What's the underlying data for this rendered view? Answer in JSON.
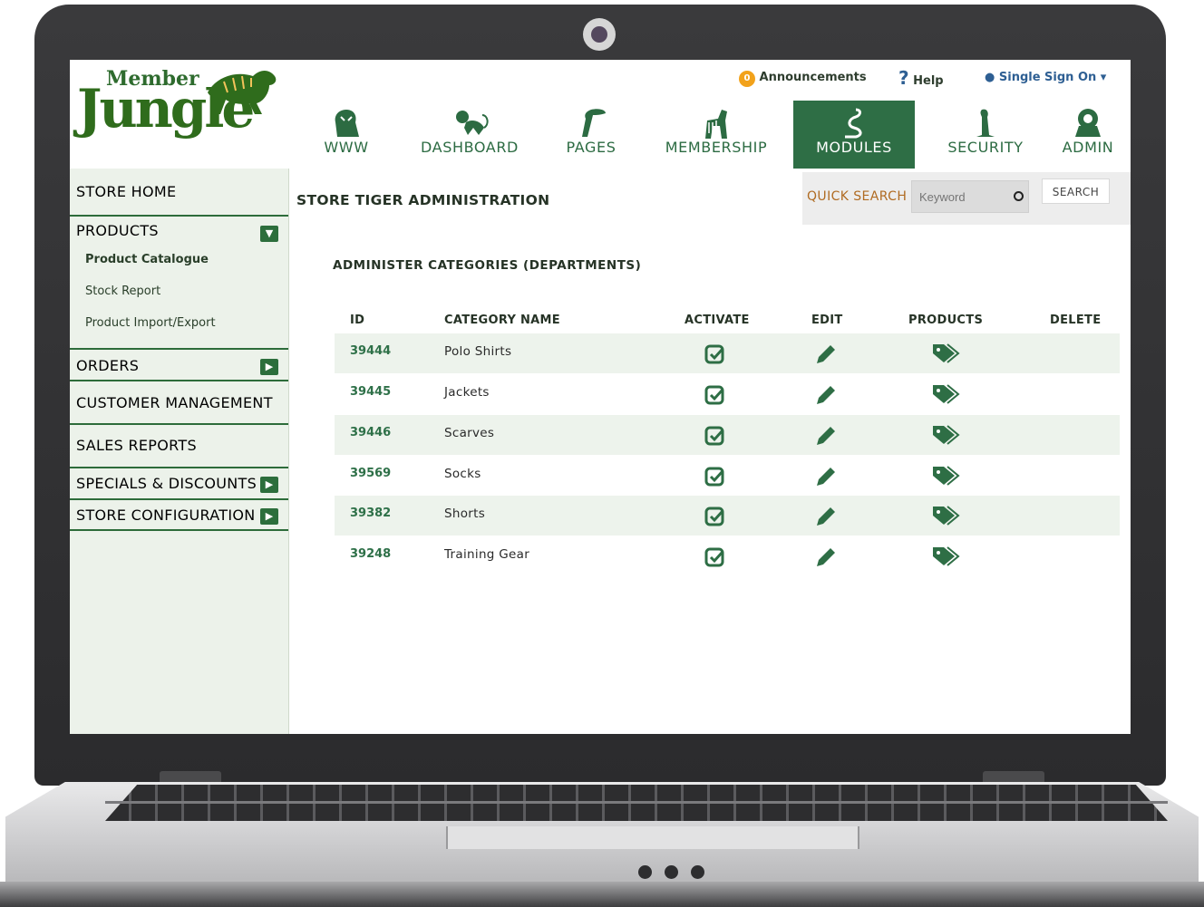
{
  "brand": {
    "word1": "Member",
    "word2": "Jungle"
  },
  "topbar": {
    "announcements_count": "0",
    "announcements": "Announcements",
    "help": "Help",
    "sso": "Single Sign On"
  },
  "tabs": [
    {
      "label": "WWW",
      "icon": "tiger-icon"
    },
    {
      "label": "DASHBOARD",
      "icon": "monkey-icon"
    },
    {
      "label": "PAGES",
      "icon": "toucan-icon"
    },
    {
      "label": "MEMBERSHIP",
      "icon": "zebra-icon"
    },
    {
      "label": "MODULES",
      "icon": "snake-icon",
      "active": true
    },
    {
      "label": "SECURITY",
      "icon": "meerkat-icon"
    },
    {
      "label": "ADMIN",
      "icon": "lion-icon"
    }
  ],
  "sidebar": {
    "store_home": "STORE HOME",
    "products": "PRODUCTS",
    "product_catalogue": "Product Catalogue",
    "stock_report": "Stock Report",
    "product_import_export": "Product Import/Export",
    "orders": "ORDERS",
    "customer_management": "CUSTOMER MANAGEMENT",
    "sales_reports": "SALES REPORTS",
    "specials_discounts": "SPECIALS & DISCOUNTS",
    "store_configuration": "STORE CONFIGURATION"
  },
  "page": {
    "title": "STORE TIGER ADMINISTRATION",
    "section_title": "ADMINISTER CATEGORIES (DEPARTMENTS)"
  },
  "quick_search": {
    "label": "QUICK SEARCH",
    "placeholder": "Keyword",
    "button": "SEARCH"
  },
  "table": {
    "headers": {
      "id": "ID",
      "name": "CATEGORY NAME",
      "activate": "ACTIVATE",
      "edit": "EDIT",
      "products": "PRODUCTS",
      "delete": "DELETE"
    },
    "rows": [
      {
        "id": "39444",
        "name": "Polo Shirts"
      },
      {
        "id": "39445",
        "name": "Jackets"
      },
      {
        "id": "39446",
        "name": "Scarves"
      },
      {
        "id": "39569",
        "name": "Socks"
      },
      {
        "id": "39382",
        "name": "Shorts"
      },
      {
        "id": "39248",
        "name": "Training Gear"
      }
    ]
  },
  "colors": {
    "brand_green": "#2e6e45",
    "sidebar_bg": "#ecf2ea",
    "accent_orange": "#b06b22",
    "badge": "#f2a21b"
  }
}
